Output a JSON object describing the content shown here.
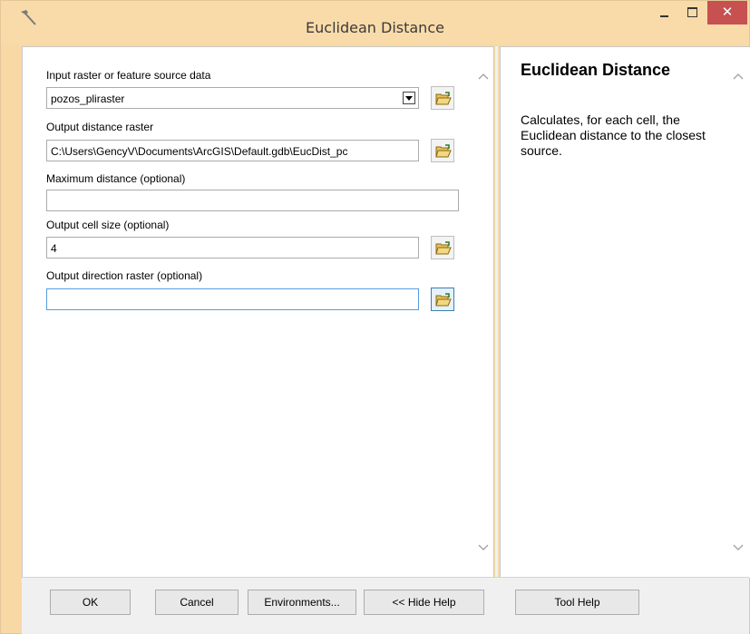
{
  "window": {
    "title": "Euclidean Distance",
    "icon": "hammer-icon",
    "close_glyph": "✕"
  },
  "form": {
    "input_label": "Input raster or feature source data",
    "input_value": "pozos_pliraster",
    "output_label": "Output distance raster",
    "output_value": "C:\\Users\\GencyV\\Documents\\ArcGIS\\Default.gdb\\EucDist_pc",
    "maxdist_label": "Maximum distance (optional)",
    "maxdist_value": "",
    "cellsize_label": "Output cell size (optional)",
    "cellsize_value": "4",
    "direction_label": "Output direction raster (optional)",
    "direction_value": ""
  },
  "help": {
    "title": "Euclidean Distance",
    "body": "Calculates, for each cell, the Euclidean distance to the closest source."
  },
  "buttons": {
    "ok": "OK",
    "cancel": "Cancel",
    "environments": "Environments...",
    "hide_help": "<< Hide Help",
    "tool_help": "Tool Help"
  },
  "colors": {
    "title_bar": "#f9dba9",
    "close_button": "#c75050",
    "focus_border": "#569de5"
  }
}
